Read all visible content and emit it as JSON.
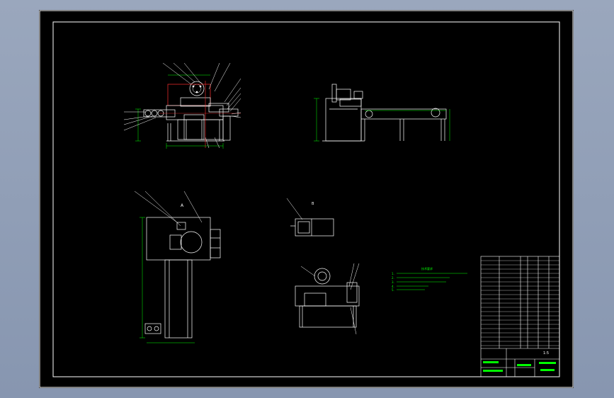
{
  "viewport": {
    "background_color": "#000000",
    "outer_background": "#8b9ab3",
    "frame_color": "#ffffff",
    "line_color_white": "#ffffff",
    "line_color_cyan": "#00ffff",
    "line_color_green": "#00ff00",
    "line_color_red": "#ff3030",
    "line_color_yellow": "#ffff00"
  },
  "drawing": {
    "section_label_a": "A",
    "section_label_b": "B",
    "notes_title": "技术要求",
    "notes_lines": [
      "1.",
      "2.",
      "3.",
      "4.",
      "5."
    ]
  },
  "title_block": {
    "scale_text": "1:5",
    "sheet_text": "1",
    "drawing_no": ""
  }
}
